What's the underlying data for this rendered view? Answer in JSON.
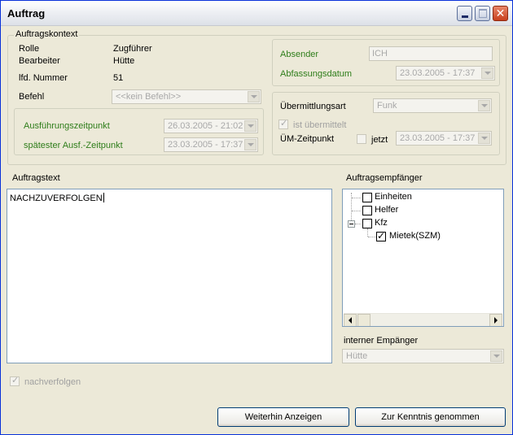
{
  "window": {
    "title": "Auftrag"
  },
  "kontext": {
    "legend": "Auftragskontext",
    "rolle_label": "Rolle",
    "rolle_value": "Zugführer",
    "bearbeiter_label": "Bearbeiter",
    "bearbeiter_value": "Hütte",
    "nummer_label": "lfd. Nummer",
    "nummer_value": "51",
    "befehl_label": "Befehl",
    "befehl_value": "<<kein Befehl>>",
    "ausfuehrung_label": "Ausführungszeitpunkt",
    "ausfuehrung_value": "26.03.2005 - 21:02",
    "spaetester_label": "spätester Ausf.-Zeitpunkt",
    "spaetester_value": "23.03.2005 - 17:37"
  },
  "absender": {
    "absender_label": "Absender",
    "absender_value": "ICH",
    "datum_label": "Abfassungsdatum",
    "datum_value": "23.03.2005 - 17:37"
  },
  "uebermittlung": {
    "art_label": "Übermittlungsart",
    "art_value": "Funk",
    "uebermittelt_label": "ist übermittelt",
    "zeitpunkt_label": "ÜM-Zeitpunkt",
    "jetzt_label": "jetzt",
    "zeitpunkt_value": "23.03.2005 - 17:37"
  },
  "text": {
    "label": "Auftragstext",
    "value": "NACHZUVERFOLGEN"
  },
  "empfaenger": {
    "label": "Auftragsempfänger",
    "items": [
      {
        "label": "Einheiten",
        "checked": false
      },
      {
        "label": "Helfer",
        "checked": false
      },
      {
        "label": "Kfz",
        "checked": false
      },
      {
        "label": "Mietek(SZM)",
        "checked": true
      }
    ]
  },
  "intern": {
    "label": "interner Empänger",
    "value": "Hütte"
  },
  "nachverfolgen": {
    "label": "nachverfolgen"
  },
  "buttons": {
    "weiterhin": "Weiterhin Anzeigen",
    "kenntnis": "Zur Kenntnis genommen"
  },
  "colors": {
    "group_label": "#2e7d1a",
    "title_border": "#0831d9",
    "close_button": "#c8401d"
  }
}
